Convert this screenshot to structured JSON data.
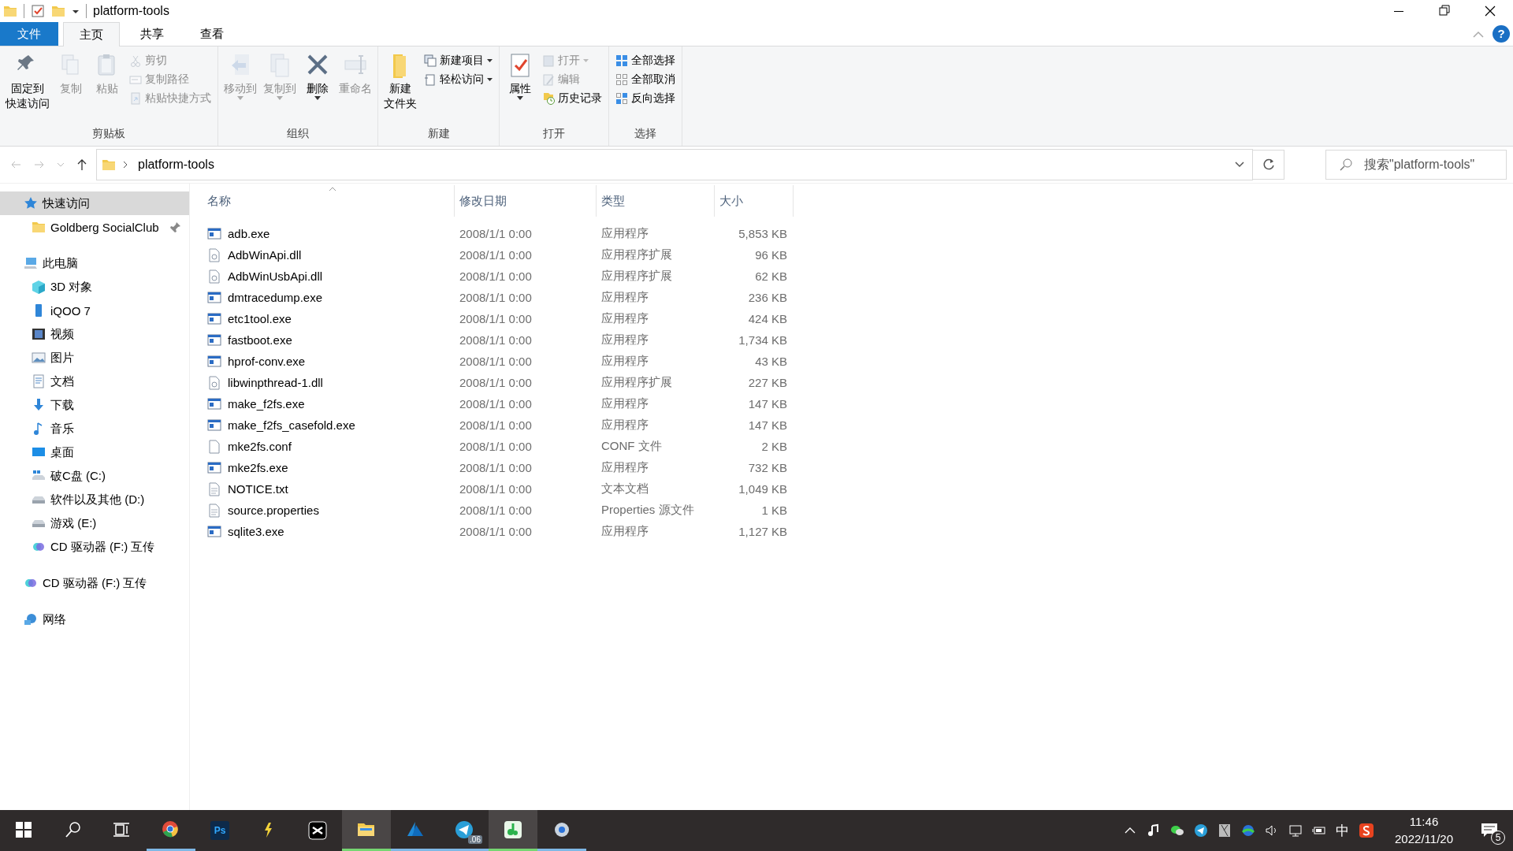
{
  "window": {
    "title": "platform-tools",
    "help_button": "?"
  },
  "ribbon_tabs": [
    {
      "label": "文件",
      "kind": "file",
      "selected": false
    },
    {
      "label": "主页",
      "kind": "tab",
      "selected": true
    },
    {
      "label": "共享",
      "kind": "tab",
      "selected": false
    },
    {
      "label": "查看",
      "kind": "tab",
      "selected": false
    }
  ],
  "ribbon": {
    "groups": [
      {
        "label": "剪贴板",
        "items": [
          {
            "kind": "large",
            "label_lines": [
              "固定到",
              "快速访问"
            ],
            "disabled": false,
            "dropdown": false
          },
          {
            "kind": "large",
            "label": "复制",
            "disabled": true,
            "dropdown": false
          },
          {
            "kind": "large",
            "label": "粘贴",
            "disabled": true,
            "dropdown": false
          },
          {
            "kind": "stack",
            "buttons": [
              {
                "label": "剪切",
                "disabled": true,
                "dropdown": false
              },
              {
                "label": "复制路径",
                "disabled": true,
                "dropdown": false
              },
              {
                "label": "粘贴快捷方式",
                "disabled": true,
                "dropdown": false
              }
            ]
          }
        ]
      },
      {
        "label": "组织",
        "items": [
          {
            "kind": "large",
            "label": "移动到",
            "disabled": true,
            "dropdown": true
          },
          {
            "kind": "large",
            "label": "复制到",
            "disabled": true,
            "dropdown": true
          },
          {
            "kind": "large",
            "label": "删除",
            "disabled": false,
            "dropdown": true
          },
          {
            "kind": "large",
            "label": "重命名",
            "disabled": true,
            "dropdown": false
          }
        ]
      },
      {
        "label": "新建",
        "items": [
          {
            "kind": "large",
            "label_lines": [
              "新建",
              "文件夹"
            ],
            "disabled": false,
            "dropdown": false
          },
          {
            "kind": "stack",
            "buttons": [
              {
                "label": "新建项目",
                "disabled": false,
                "dropdown": true
              },
              {
                "label": "轻松访问",
                "disabled": false,
                "dropdown": true
              }
            ]
          }
        ]
      },
      {
        "label": "打开",
        "items": [
          {
            "kind": "large",
            "label": "属性",
            "disabled": false,
            "dropdown": true
          },
          {
            "kind": "stack",
            "buttons": [
              {
                "label": "打开",
                "disabled": true,
                "dropdown": true
              },
              {
                "label": "编辑",
                "disabled": true,
                "dropdown": false
              },
              {
                "label": "历史记录",
                "disabled": false,
                "dropdown": false
              }
            ]
          }
        ]
      },
      {
        "label": "选择",
        "items": [
          {
            "kind": "stack",
            "buttons": [
              {
                "label": "全部选择",
                "disabled": false,
                "dropdown": false
              },
              {
                "label": "全部取消",
                "disabled": false,
                "dropdown": false
              },
              {
                "label": "反向选择",
                "disabled": false,
                "dropdown": false
              }
            ]
          }
        ]
      }
    ]
  },
  "address_bar": {
    "path": [
      "platform-tools"
    ],
    "search_placeholder": "搜索\"platform-tools\""
  },
  "navigation": [
    {
      "label": "快速访问",
      "selected": true,
      "children": [
        {
          "label": "Goldberg SocialClub",
          "pinned": true,
          "selected": false
        }
      ]
    },
    {
      "label": "此电脑",
      "selected": false,
      "children": [
        {
          "label": "3D 对象",
          "selected": false
        },
        {
          "label": "iQOO 7",
          "selected": false
        },
        {
          "label": "视频",
          "selected": false
        },
        {
          "label": "图片",
          "selected": false
        },
        {
          "label": "文档",
          "selected": false
        },
        {
          "label": "下载",
          "selected": false
        },
        {
          "label": "音乐",
          "selected": false
        },
        {
          "label": "桌面",
          "selected": false
        },
        {
          "label": "破C盘 (C:)",
          "selected": false
        },
        {
          "label": "软件以及其他 (D:)",
          "selected": false
        },
        {
          "label": "游戏 (E:)",
          "selected": false
        },
        {
          "label": "CD 驱动器 (F:) 互传",
          "selected": false
        }
      ]
    },
    {
      "label": "CD 驱动器 (F:) 互传",
      "selected": false
    },
    {
      "label": "网络",
      "selected": false
    }
  ],
  "table": {
    "columns": [
      {
        "label": "名称",
        "sorted": true
      },
      {
        "label": "修改日期",
        "sorted": false
      },
      {
        "label": "类型",
        "sorted": false
      },
      {
        "label": "大小",
        "sorted": false
      }
    ],
    "rows": [
      {
        "kind": "app",
        "name": "adb.exe",
        "date": "2008/1/1 0:00",
        "type": "应用程序",
        "size": "5,853 KB"
      },
      {
        "kind": "dll",
        "name": "AdbWinApi.dll",
        "date": "2008/1/1 0:00",
        "type": "应用程序扩展",
        "size": "96 KB"
      },
      {
        "kind": "dll",
        "name": "AdbWinUsbApi.dll",
        "date": "2008/1/1 0:00",
        "type": "应用程序扩展",
        "size": "62 KB"
      },
      {
        "kind": "app",
        "name": "dmtracedump.exe",
        "date": "2008/1/1 0:00",
        "type": "应用程序",
        "size": "236 KB"
      },
      {
        "kind": "app",
        "name": "etc1tool.exe",
        "date": "2008/1/1 0:00",
        "type": "应用程序",
        "size": "424 KB"
      },
      {
        "kind": "app",
        "name": "fastboot.exe",
        "date": "2008/1/1 0:00",
        "type": "应用程序",
        "size": "1,734 KB"
      },
      {
        "kind": "app",
        "name": "hprof-conv.exe",
        "date": "2008/1/1 0:00",
        "type": "应用程序",
        "size": "43 KB"
      },
      {
        "kind": "dll",
        "name": "libwinpthread-1.dll",
        "date": "2008/1/1 0:00",
        "type": "应用程序扩展",
        "size": "227 KB"
      },
      {
        "kind": "app",
        "name": "make_f2fs.exe",
        "date": "2008/1/1 0:00",
        "type": "应用程序",
        "size": "147 KB"
      },
      {
        "kind": "app",
        "name": "make_f2fs_casefold.exe",
        "date": "2008/1/1 0:00",
        "type": "应用程序",
        "size": "147 KB"
      },
      {
        "kind": "file",
        "name": "mke2fs.conf",
        "date": "2008/1/1 0:00",
        "type": "CONF 文件",
        "size": "2 KB"
      },
      {
        "kind": "app",
        "name": "mke2fs.exe",
        "date": "2008/1/1 0:00",
        "type": "应用程序",
        "size": "732 KB"
      },
      {
        "kind": "text",
        "name": "NOTICE.txt",
        "date": "2008/1/1 0:00",
        "type": "文本文档",
        "size": "1,049 KB"
      },
      {
        "kind": "text",
        "name": "source.properties",
        "date": "2008/1/1 0:00",
        "type": "Properties 源文件",
        "size": "1 KB"
      },
      {
        "kind": "app",
        "name": "sqlite3.exe",
        "date": "2008/1/1 0:00",
        "type": "应用程序",
        "size": "1,127 KB"
      }
    ]
  },
  "taskbar": {
    "apps": [
      {
        "running": false,
        "active": false
      },
      {
        "running": false,
        "active": false
      },
      {
        "running": false,
        "active": false
      },
      {
        "running": true,
        "active": false
      },
      {
        "running": false,
        "active": false,
        "label": "Ps"
      },
      {
        "running": false,
        "active": false
      },
      {
        "running": false,
        "active": false
      },
      {
        "running": true,
        "active": true
      },
      {
        "running": true,
        "active": false
      },
      {
        "running": true,
        "active": false,
        "badge": ".06"
      },
      {
        "running": true,
        "active": true
      },
      {
        "running": true,
        "active": false
      }
    ],
    "input_method": "中",
    "time": "11:46",
    "date": "2022/11/20",
    "notifications": "5"
  }
}
